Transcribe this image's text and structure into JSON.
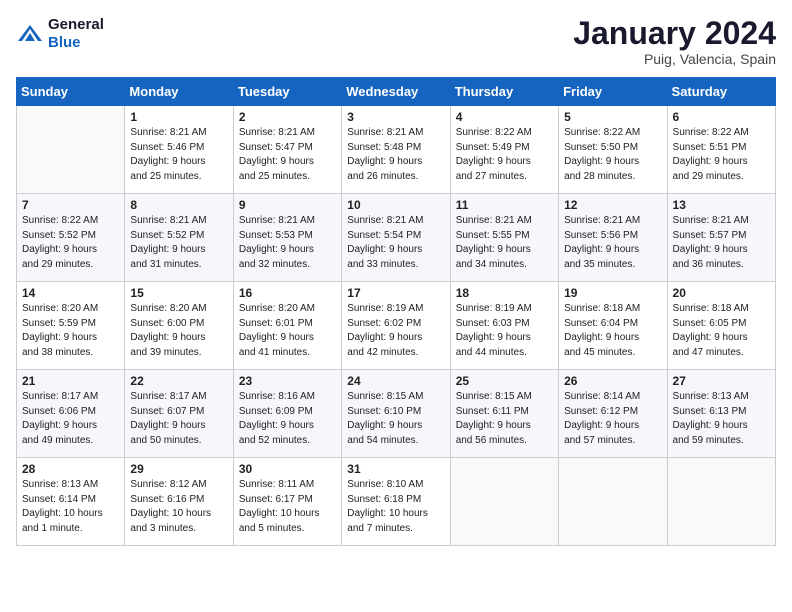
{
  "header": {
    "logo_general": "General",
    "logo_blue": "Blue",
    "month": "January 2024",
    "location": "Puig, Valencia, Spain"
  },
  "weekdays": [
    "Sunday",
    "Monday",
    "Tuesday",
    "Wednesday",
    "Thursday",
    "Friday",
    "Saturday"
  ],
  "weeks": [
    [
      {
        "day": "",
        "info": ""
      },
      {
        "day": "1",
        "info": "Sunrise: 8:21 AM\nSunset: 5:46 PM\nDaylight: 9 hours\nand 25 minutes."
      },
      {
        "day": "2",
        "info": "Sunrise: 8:21 AM\nSunset: 5:47 PM\nDaylight: 9 hours\nand 25 minutes."
      },
      {
        "day": "3",
        "info": "Sunrise: 8:21 AM\nSunset: 5:48 PM\nDaylight: 9 hours\nand 26 minutes."
      },
      {
        "day": "4",
        "info": "Sunrise: 8:22 AM\nSunset: 5:49 PM\nDaylight: 9 hours\nand 27 minutes."
      },
      {
        "day": "5",
        "info": "Sunrise: 8:22 AM\nSunset: 5:50 PM\nDaylight: 9 hours\nand 28 minutes."
      },
      {
        "day": "6",
        "info": "Sunrise: 8:22 AM\nSunset: 5:51 PM\nDaylight: 9 hours\nand 29 minutes."
      }
    ],
    [
      {
        "day": "7",
        "info": "Sunrise: 8:22 AM\nSunset: 5:52 PM\nDaylight: 9 hours\nand 29 minutes."
      },
      {
        "day": "8",
        "info": "Sunrise: 8:21 AM\nSunset: 5:52 PM\nDaylight: 9 hours\nand 31 minutes."
      },
      {
        "day": "9",
        "info": "Sunrise: 8:21 AM\nSunset: 5:53 PM\nDaylight: 9 hours\nand 32 minutes."
      },
      {
        "day": "10",
        "info": "Sunrise: 8:21 AM\nSunset: 5:54 PM\nDaylight: 9 hours\nand 33 minutes."
      },
      {
        "day": "11",
        "info": "Sunrise: 8:21 AM\nSunset: 5:55 PM\nDaylight: 9 hours\nand 34 minutes."
      },
      {
        "day": "12",
        "info": "Sunrise: 8:21 AM\nSunset: 5:56 PM\nDaylight: 9 hours\nand 35 minutes."
      },
      {
        "day": "13",
        "info": "Sunrise: 8:21 AM\nSunset: 5:57 PM\nDaylight: 9 hours\nand 36 minutes."
      }
    ],
    [
      {
        "day": "14",
        "info": "Sunrise: 8:20 AM\nSunset: 5:59 PM\nDaylight: 9 hours\nand 38 minutes."
      },
      {
        "day": "15",
        "info": "Sunrise: 8:20 AM\nSunset: 6:00 PM\nDaylight: 9 hours\nand 39 minutes."
      },
      {
        "day": "16",
        "info": "Sunrise: 8:20 AM\nSunset: 6:01 PM\nDaylight: 9 hours\nand 41 minutes."
      },
      {
        "day": "17",
        "info": "Sunrise: 8:19 AM\nSunset: 6:02 PM\nDaylight: 9 hours\nand 42 minutes."
      },
      {
        "day": "18",
        "info": "Sunrise: 8:19 AM\nSunset: 6:03 PM\nDaylight: 9 hours\nand 44 minutes."
      },
      {
        "day": "19",
        "info": "Sunrise: 8:18 AM\nSunset: 6:04 PM\nDaylight: 9 hours\nand 45 minutes."
      },
      {
        "day": "20",
        "info": "Sunrise: 8:18 AM\nSunset: 6:05 PM\nDaylight: 9 hours\nand 47 minutes."
      }
    ],
    [
      {
        "day": "21",
        "info": "Sunrise: 8:17 AM\nSunset: 6:06 PM\nDaylight: 9 hours\nand 49 minutes."
      },
      {
        "day": "22",
        "info": "Sunrise: 8:17 AM\nSunset: 6:07 PM\nDaylight: 9 hours\nand 50 minutes."
      },
      {
        "day": "23",
        "info": "Sunrise: 8:16 AM\nSunset: 6:09 PM\nDaylight: 9 hours\nand 52 minutes."
      },
      {
        "day": "24",
        "info": "Sunrise: 8:15 AM\nSunset: 6:10 PM\nDaylight: 9 hours\nand 54 minutes."
      },
      {
        "day": "25",
        "info": "Sunrise: 8:15 AM\nSunset: 6:11 PM\nDaylight: 9 hours\nand 56 minutes."
      },
      {
        "day": "26",
        "info": "Sunrise: 8:14 AM\nSunset: 6:12 PM\nDaylight: 9 hours\nand 57 minutes."
      },
      {
        "day": "27",
        "info": "Sunrise: 8:13 AM\nSunset: 6:13 PM\nDaylight: 9 hours\nand 59 minutes."
      }
    ],
    [
      {
        "day": "28",
        "info": "Sunrise: 8:13 AM\nSunset: 6:14 PM\nDaylight: 10 hours\nand 1 minute."
      },
      {
        "day": "29",
        "info": "Sunrise: 8:12 AM\nSunset: 6:16 PM\nDaylight: 10 hours\nand 3 minutes."
      },
      {
        "day": "30",
        "info": "Sunrise: 8:11 AM\nSunset: 6:17 PM\nDaylight: 10 hours\nand 5 minutes."
      },
      {
        "day": "31",
        "info": "Sunrise: 8:10 AM\nSunset: 6:18 PM\nDaylight: 10 hours\nand 7 minutes."
      },
      {
        "day": "",
        "info": ""
      },
      {
        "day": "",
        "info": ""
      },
      {
        "day": "",
        "info": ""
      }
    ]
  ]
}
